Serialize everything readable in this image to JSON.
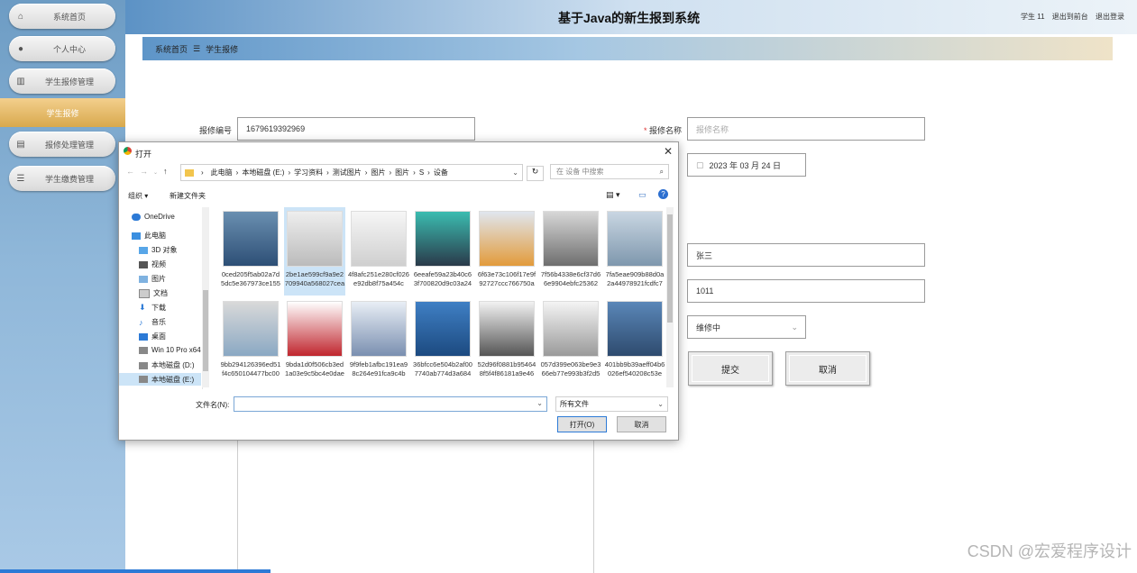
{
  "sidebar": {
    "items": [
      {
        "label": "系统首页",
        "icon": "home-icon"
      },
      {
        "label": "个人中心",
        "icon": "user-icon"
      },
      {
        "label": "学生报修管理",
        "icon": "chart-icon"
      },
      {
        "label": "报修处理管理",
        "icon": "document-icon"
      },
      {
        "label": "学生缴费管理",
        "icon": "list-icon"
      }
    ],
    "sub_item": "学生报修"
  },
  "header": {
    "title": "基于Java的新生报到系统",
    "user": "学生 11",
    "exit_front": "退出到前台",
    "logout": "退出登录"
  },
  "breadcrumb": {
    "home": "系统首页",
    "current": "学生报修"
  },
  "form": {
    "repair_no_label": "报修编号",
    "repair_no_value": "1679619392969",
    "repair_name_label": "报修名称",
    "repair_name_placeholder": "报修名称",
    "date_value": "2023 年 03 月 24 日",
    "name_value": "张三",
    "room_value": "1011",
    "status_value": "维修中",
    "submit": "提交",
    "cancel": "取消"
  },
  "dialog": {
    "title": "打开",
    "path": [
      "此电脑",
      "本地磁盘 (E:)",
      "学习资料",
      "测试图片",
      "图片",
      "图片",
      "S",
      "设备"
    ],
    "search_placeholder": "在 设备 中搜索",
    "organize": "组织 ▾",
    "new_folder": "新建文件夹",
    "tree": [
      "OneDrive",
      "此电脑",
      "3D 对象",
      "视频",
      "图片",
      "文档",
      "下载",
      "音乐",
      "桌面",
      "Win 10 Pro x64",
      "本地磁盘 (D:)",
      "本地磁盘 (E:)"
    ],
    "files": [
      "0ced205f5ab02a7d5dc5e367973ce155",
      "2be1ae599cf9a9e2709940a568027cea",
      "4f8afc251e280cf026e92db8f75a454c",
      "6eeafe59a23b40c63f700820d9c03a24",
      "6f63e73c106f17e9f92727ccc766750a",
      "7f56b4338e6cf37d66e9904ebfc25362",
      "7fa5eae909b88d0a2a44978921fcdfc7",
      "9bb294126396ed51f4c650104477bc00",
      "9bda1d0f506cb3ed1a03e9c5bc4e0dae",
      "9f9feb1afbc191ea98c264e91fca9c4b",
      "36bfcc6e504b2af007740ab774d3a684",
      "52d96f0881b954648f5f4f86181a9e46",
      "057d399e063be9e366eb77e993b3f2d5",
      "401bb9b39aeff04b6026ef540208c53e"
    ],
    "filename_label": "文件名(N):",
    "filetype": "所有文件",
    "open": "打开(O)",
    "cancel": "取消"
  },
  "watermark": "CSDN @宏爱程序设计",
  "colors": {
    "accent": "#d8a94d",
    "sidebar": "#8fb7d9"
  }
}
